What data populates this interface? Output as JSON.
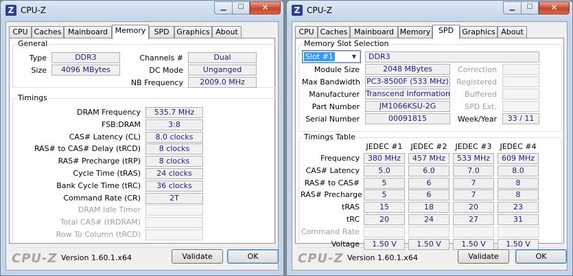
{
  "left": {
    "title": "CPU-Z",
    "tabs": [
      "CPU",
      "Caches",
      "Mainboard",
      "Memory",
      "SPD",
      "Graphics",
      "About"
    ],
    "active_tab": "Memory",
    "general": {
      "title": "General",
      "type_label": "Type",
      "type_value": "DDR3",
      "size_label": "Size",
      "size_value": "4096 MBytes",
      "channels_label": "Channels #",
      "channels_value": "Dual",
      "dcmode_label": "DC Mode",
      "dcmode_value": "Unganged",
      "nbfreq_label": "NB Frequency",
      "nbfreq_value": "2009.0 MHz"
    },
    "timings": {
      "title": "Timings",
      "rows": [
        {
          "label": "DRAM Frequency",
          "value": "535.7 MHz",
          "disabled": false
        },
        {
          "label": "FSB:DRAM",
          "value": "3:8",
          "disabled": false
        },
        {
          "label": "CAS# Latency (CL)",
          "value": "8.0 clocks",
          "disabled": false
        },
        {
          "label": "RAS# to CAS# Delay (tRCD)",
          "value": "8 clocks",
          "disabled": false
        },
        {
          "label": "RAS# Precharge (tRP)",
          "value": "8 clocks",
          "disabled": false
        },
        {
          "label": "Cycle Time (tRAS)",
          "value": "24 clocks",
          "disabled": false
        },
        {
          "label": "Bank Cycle Time (tRC)",
          "value": "36 clocks",
          "disabled": false
        },
        {
          "label": "Command Rate (CR)",
          "value": "2T",
          "disabled": false
        },
        {
          "label": "DRAM Idle Timer",
          "value": "",
          "disabled": true
        },
        {
          "label": "Total CAS# (tRDRAM)",
          "value": "",
          "disabled": true
        },
        {
          "label": "Row To Column (tRCD)",
          "value": "",
          "disabled": true
        }
      ]
    },
    "footer": {
      "logo": "CPU-Z",
      "version": "Version 1.60.1.x64",
      "validate": "Validate",
      "ok": "OK"
    }
  },
  "right": {
    "title": "CPU-Z",
    "tabs": [
      "CPU",
      "Caches",
      "Mainboard",
      "Memory",
      "SPD",
      "Graphics",
      "About"
    ],
    "active_tab": "SPD",
    "slot": {
      "title": "Memory Slot Selection",
      "selected": "Slot #1",
      "type": "DDR3",
      "module_size_label": "Module Size",
      "module_size": "2048 MBytes",
      "max_bw_label": "Max Bandwidth",
      "max_bw": "PC3-8500F (533 MHz)",
      "manufacturer_label": "Manufacturer",
      "manufacturer": "Transcend Information",
      "part_label": "Part Number",
      "part": "JM1066KSU-2G",
      "serial_label": "Serial Number",
      "serial": "00091815",
      "correction_label": "Correction",
      "registered_label": "Registered",
      "buffered_label": "Buffered",
      "spdext_label": "SPD Ext.",
      "weekyear_label": "Week/Year",
      "weekyear": "33 / 11"
    },
    "timings_table": {
      "title": "Timings Table",
      "columns": [
        "JEDEC #1",
        "JEDEC #2",
        "JEDEC #3",
        "JEDEC #4"
      ],
      "rows": [
        {
          "label": "Frequency",
          "values": [
            "380 MHz",
            "457 MHz",
            "533 MHz",
            "609 MHz"
          ],
          "disabled": false
        },
        {
          "label": "CAS# Latency",
          "values": [
            "5.0",
            "6.0",
            "7.0",
            "8.0"
          ],
          "disabled": false
        },
        {
          "label": "RAS# to CAS#",
          "values": [
            "5",
            "6",
            "7",
            "8"
          ],
          "disabled": false
        },
        {
          "label": "RAS# Precharge",
          "values": [
            "5",
            "6",
            "7",
            "8"
          ],
          "disabled": false
        },
        {
          "label": "tRAS",
          "values": [
            "15",
            "18",
            "20",
            "23"
          ],
          "disabled": false
        },
        {
          "label": "tRC",
          "values": [
            "20",
            "24",
            "27",
            "31"
          ],
          "disabled": false
        },
        {
          "label": "Command Rate",
          "values": [
            "",
            "",
            "",
            ""
          ],
          "disabled": true
        },
        {
          "label": "Voltage",
          "values": [
            "1.50 V",
            "1.50 V",
            "1.50 V",
            "1.50 V"
          ],
          "disabled": false
        }
      ]
    },
    "footer": {
      "logo": "CPU-Z",
      "version": "Version 1.60.1.x64",
      "validate": "Validate",
      "ok": "OK"
    }
  }
}
